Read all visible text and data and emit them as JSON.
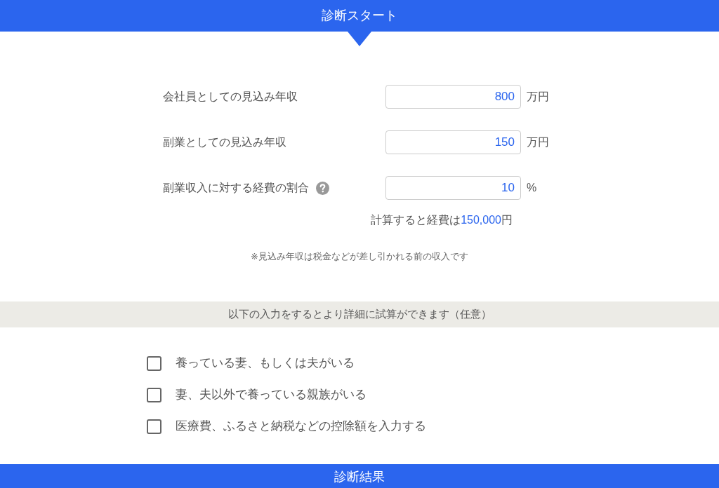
{
  "header": {
    "title": "診断スタート"
  },
  "fields": [
    {
      "label": "会社員としての見込み年収",
      "value": "800",
      "unit": "万円",
      "help": false
    },
    {
      "label": "副業としての見込み年収",
      "value": "150",
      "unit": "万円",
      "help": false
    },
    {
      "label": "副業収入に対する経費の割合",
      "value": "10",
      "unit": "%",
      "help": true
    }
  ],
  "expense_result": {
    "prefix": "計算すると経費は",
    "amount": "150,000",
    "suffix": "円"
  },
  "note": "※見込み年収は税金などが差し引かれる前の収入です",
  "optional_band": {
    "text": "以下の入力をするとより詳細に試算ができます（任意）"
  },
  "options": [
    {
      "label": "養っている妻、もしくは夫がいる",
      "checked": false
    },
    {
      "label": "妻、夫以外で養っている親族がいる",
      "checked": false
    },
    {
      "label": "医療費、ふるさと納税などの控除額を入力する",
      "checked": false
    }
  ],
  "result_header": {
    "title": "診断結果"
  }
}
